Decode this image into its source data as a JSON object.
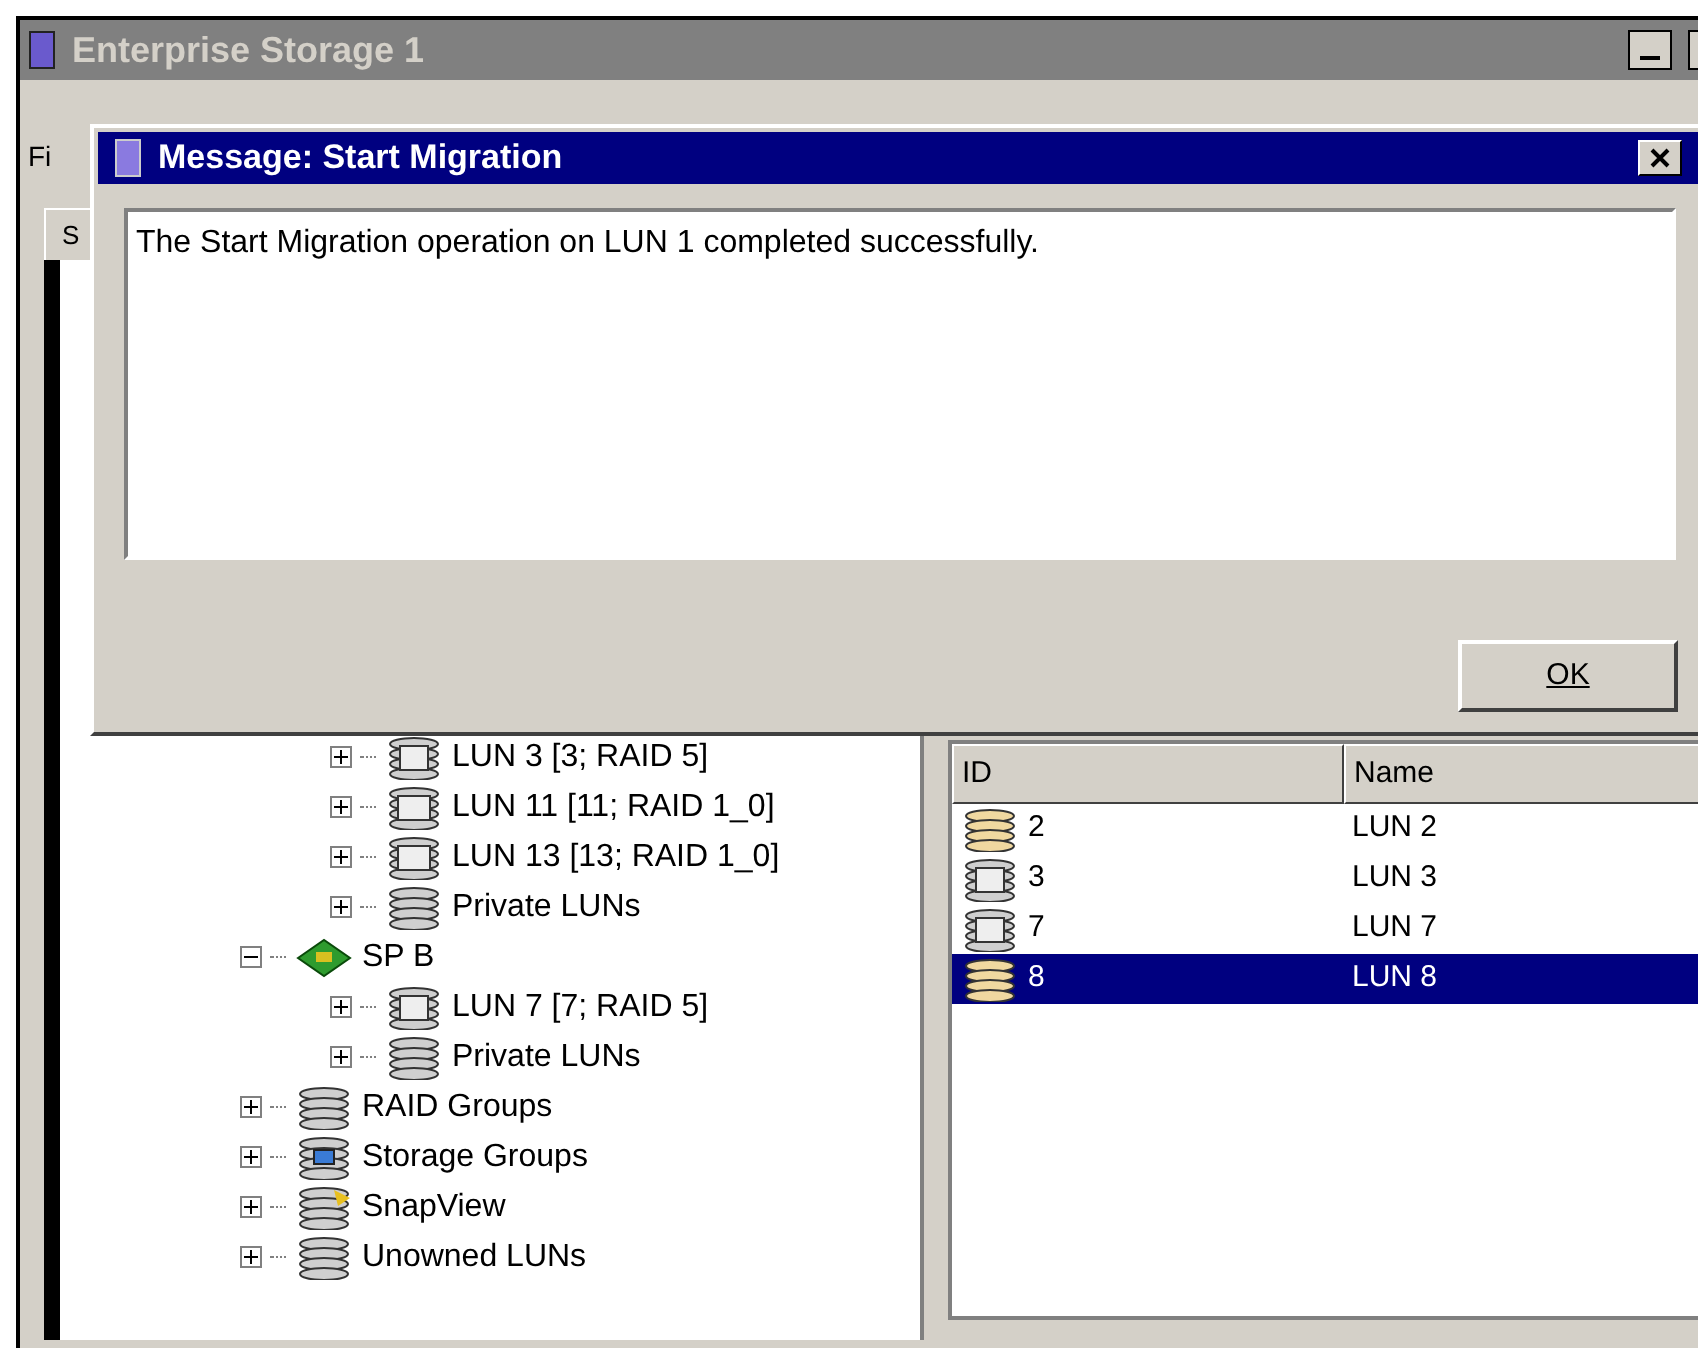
{
  "window": {
    "title": "Enterprise Storage 1"
  },
  "toolbar": {
    "label": "Fi"
  },
  "tabs": [
    {
      "label": "S",
      "selected": true
    }
  ],
  "tree": [
    {
      "children": [
        {
          "label": "LUN 3 [3; RAID 5]",
          "kind": "raid5",
          "expanded": false
        },
        {
          "label": "LUN 11 [11; RAID 1_0]",
          "kind": "raid10",
          "expanded": false
        },
        {
          "label": "LUN 13 [13; RAID 1_0]",
          "kind": "raid10",
          "expanded": false
        },
        {
          "label": "Private LUNs",
          "kind": "stack",
          "expanded": false
        }
      ]
    },
    {
      "label": "SP B",
      "kind": "sp",
      "expanded": true,
      "children": [
        {
          "label": "LUN 7 [7; RAID 5]",
          "kind": "raid5",
          "expanded": false
        },
        {
          "label": "Private LUNs",
          "kind": "stack",
          "expanded": false
        }
      ]
    },
    {
      "label": "RAID Groups",
      "kind": "raidgroups",
      "expanded": false
    },
    {
      "label": "Storage Groups",
      "kind": "storagegroups",
      "expanded": false
    },
    {
      "label": "SnapView",
      "kind": "snapview",
      "expanded": false
    },
    {
      "label": "Unowned LUNs",
      "kind": "stack",
      "expanded": false
    }
  ],
  "table": {
    "columns": [
      "ID",
      "Name"
    ],
    "rows": [
      {
        "kind": "plain",
        "id": "2",
        "name": "LUN 2",
        "selected": false
      },
      {
        "kind": "raid5",
        "id": "3",
        "name": "LUN 3",
        "selected": false
      },
      {
        "kind": "raid5",
        "id": "7",
        "name": "LUN 7",
        "selected": false
      },
      {
        "kind": "plain",
        "id": "8",
        "name": "LUN 8",
        "selected": true
      }
    ]
  },
  "dialog": {
    "title": "Message: Start Migration",
    "message": "The Start Migration operation on LUN 1 completed successfully.",
    "button": "OK"
  }
}
